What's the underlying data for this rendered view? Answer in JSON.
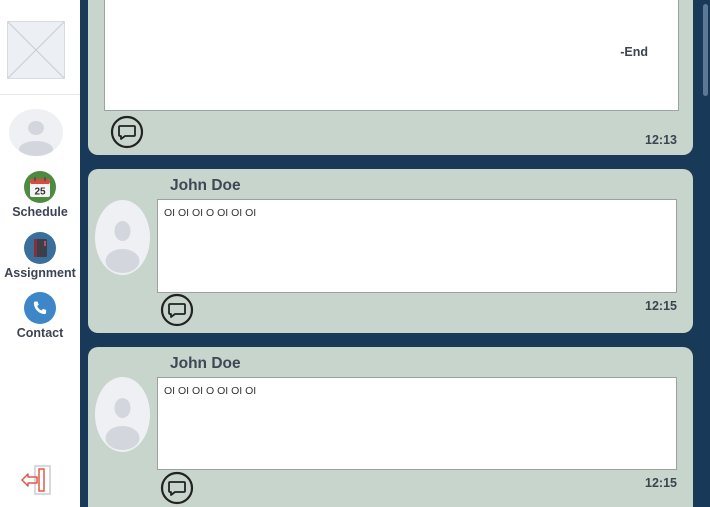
{
  "sidebar": {
    "logo_icon": "image-placeholder-icon",
    "avatar_icon": "user-avatar-icon",
    "items": [
      {
        "label": "Schedule",
        "icon": "calendar-icon",
        "icon_text": "25",
        "color": "#4e8a3f"
      },
      {
        "label": "Assignment",
        "icon": "notebook-icon",
        "color": "#3a6f9b"
      },
      {
        "label": "Contact",
        "icon": "phone-icon",
        "color": "#3d86c8"
      }
    ],
    "logout_icon": "logout-icon"
  },
  "messages": [
    {
      "author": "",
      "text": "",
      "end_text": "-End",
      "time": "12:13"
    },
    {
      "author": "John Doe",
      "text": "OI OI OI O OI OI OI",
      "time": "12:15"
    },
    {
      "author": "John Doe",
      "text": "OI OI OI O OI OI OI",
      "time": "12:15"
    }
  ],
  "colors": {
    "main_bg": "#183a58",
    "card_bg": "#c8d5cc",
    "text_dark": "#3c4450"
  }
}
